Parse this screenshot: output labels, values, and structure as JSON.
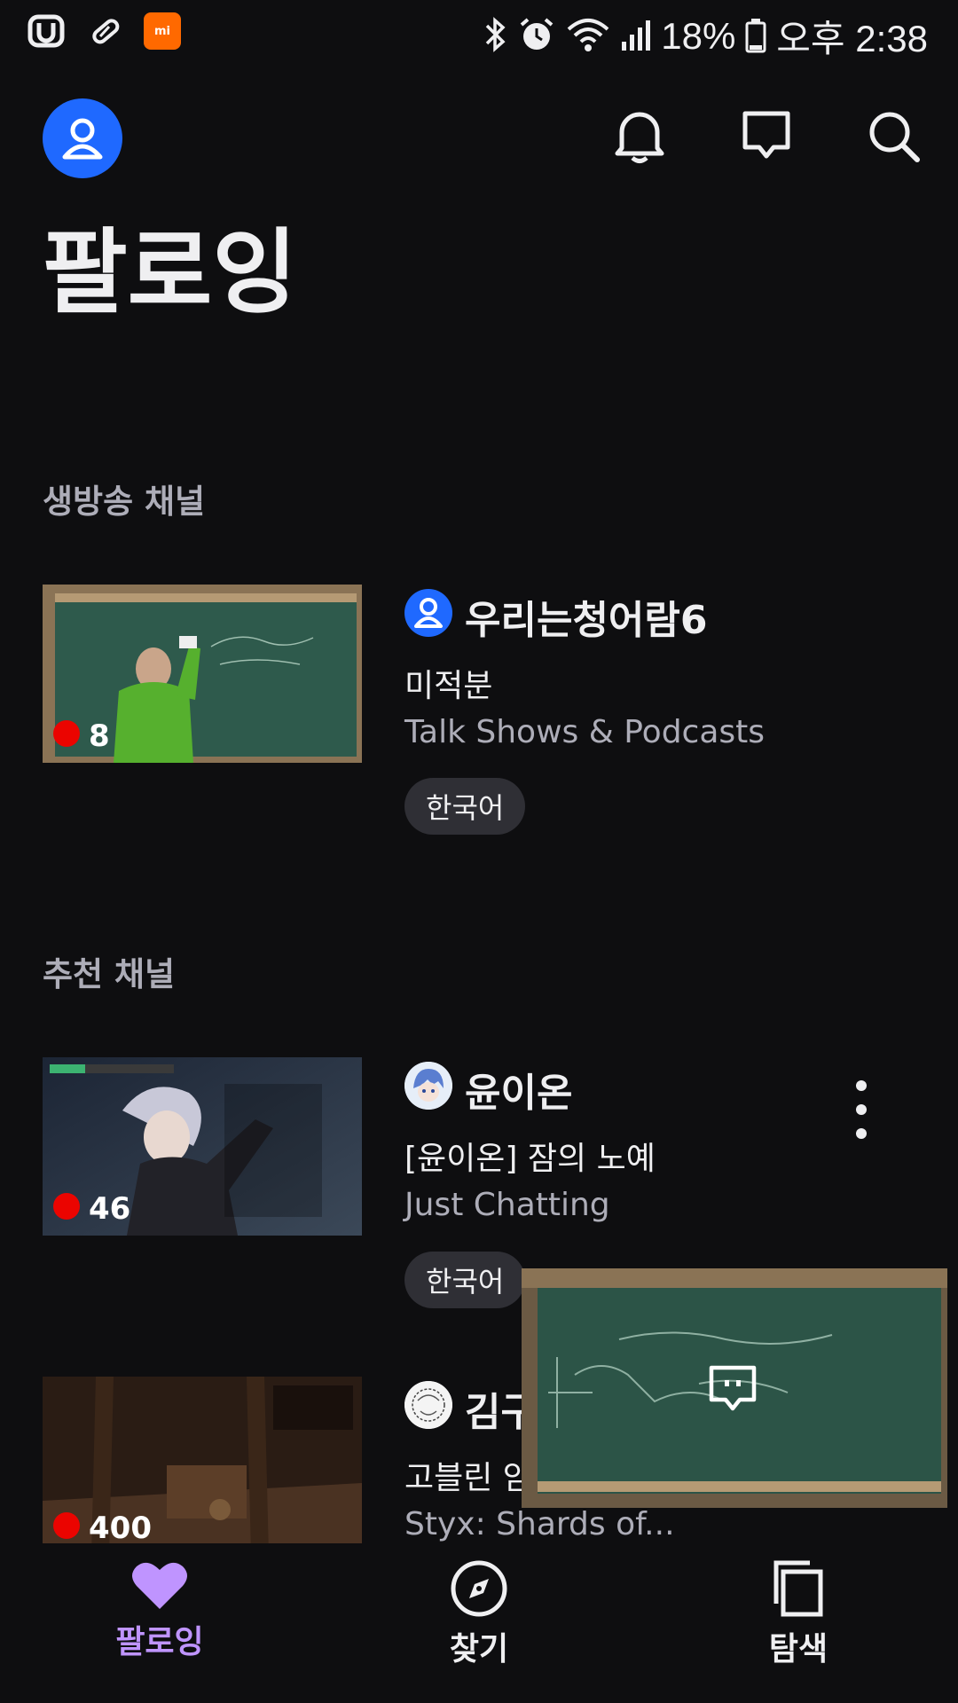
{
  "status_bar": {
    "icons_left": [
      "u-app-icon",
      "pill-icon",
      "mi-app-icon"
    ],
    "mi_label": "mi",
    "icons_right": [
      "bluetooth-icon",
      "alarm-icon",
      "wifi-icon",
      "signal-icon"
    ],
    "battery": "18%",
    "time": "오후 2:38"
  },
  "header": {
    "title": "팔로잉",
    "icons": [
      "profile-icon",
      "bell-icon",
      "inbox-icon",
      "search-icon"
    ]
  },
  "live_section": {
    "title": "생방송 채널",
    "channels": [
      {
        "name": "우리는청어람6",
        "stream_title": "미적분",
        "category": "Talk Shows & Podcasts",
        "tag": "한국어",
        "viewers": "8"
      }
    ]
  },
  "recommended_section": {
    "title": "추천 채널",
    "channels": [
      {
        "name": "윤이온",
        "stream_title": "[윤이온]  잠의 노예",
        "category": "Just Chatting",
        "tag": "한국어",
        "viewers": "46"
      },
      {
        "name": "김구",
        "stream_title": "고블린 암",
        "category": "Styx: Shards of...",
        "viewers": "400"
      }
    ]
  },
  "bottom_nav": {
    "items": [
      {
        "label": "팔로잉",
        "icon": "heart-icon",
        "active": true
      },
      {
        "label": "찾기",
        "icon": "compass-icon",
        "active": false
      },
      {
        "label": "탐색",
        "icon": "browse-icon",
        "active": false
      }
    ]
  },
  "colors": {
    "background": "#0e0e10",
    "accent_purple": "#bf94ff",
    "live_red": "#eb0400",
    "avatar_blue": "#1f69ff",
    "muted_text": "#adadb8"
  }
}
